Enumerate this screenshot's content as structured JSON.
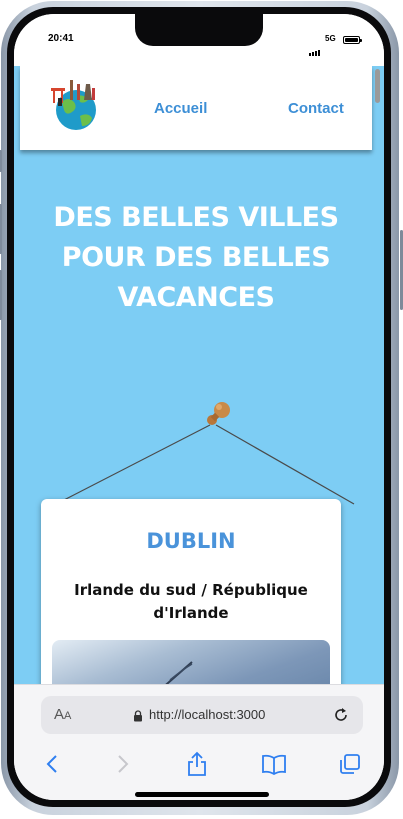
{
  "status_bar": {
    "time": "20:41",
    "network": "5G",
    "icons": [
      "signal-icon",
      "battery-icon"
    ]
  },
  "site": {
    "nav": {
      "logo_icon": "globe-landmarks-logo",
      "links": [
        "Accueil",
        "Contact"
      ]
    },
    "hero": {
      "title": "DES BELLES VILLES POUR DES BELLES VACANCES"
    },
    "card": {
      "title": "DUBLIN",
      "subtitle": "Irlande du sud / République d'Irlande",
      "image_icon": "dublin-photo"
    }
  },
  "browser": {
    "text_size_label_large": "A",
    "text_size_label_small": "A",
    "url": "http://localhost:3000",
    "icons": [
      "lock-icon",
      "reload-icon",
      "back-icon",
      "forward-icon",
      "share-icon",
      "bookmarks-icon",
      "tabs-icon"
    ]
  },
  "colors": {
    "page_background": "#7dcdf4",
    "accent": "#3d8fd6",
    "card_title": "#4a93da",
    "ios_blue": "#2f7ff0"
  }
}
